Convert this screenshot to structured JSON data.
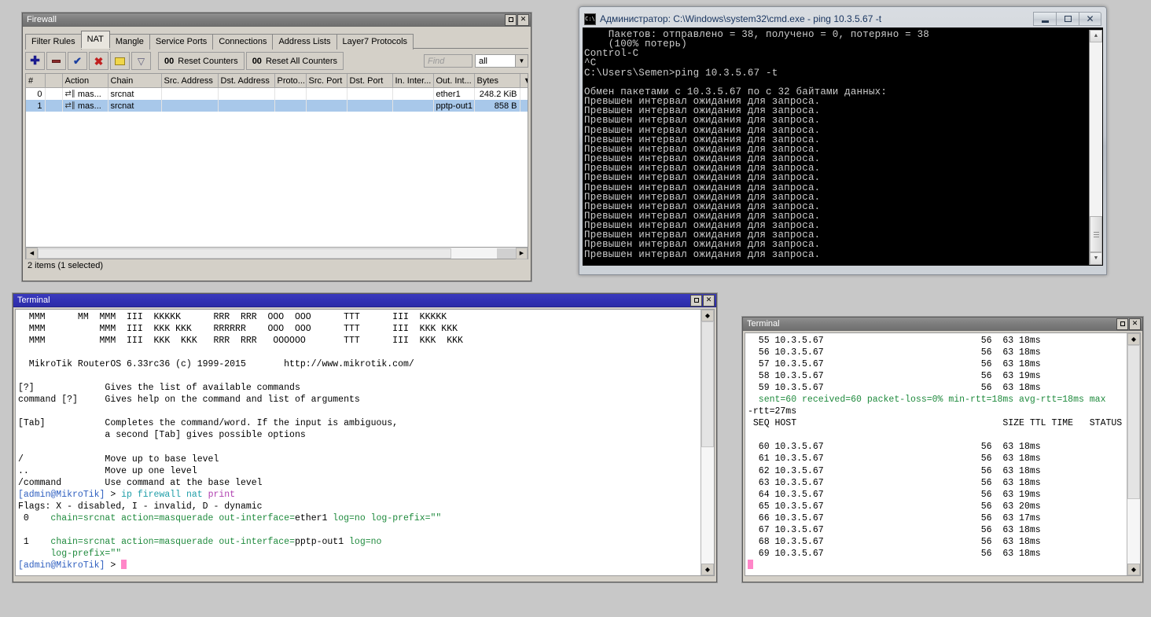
{
  "firewall": {
    "title": "Firewall",
    "window_buttons": {
      "maximize": "maximize-icon",
      "close": "x"
    },
    "tabs": [
      {
        "label": "Filter Rules",
        "active": false
      },
      {
        "label": "NAT",
        "active": true
      },
      {
        "label": "Mangle",
        "active": false
      },
      {
        "label": "Service Ports",
        "active": false
      },
      {
        "label": "Connections",
        "active": false
      },
      {
        "label": "Address Lists",
        "active": false
      },
      {
        "label": "Layer7 Protocols",
        "active": false
      }
    ],
    "toolbar": {
      "add": "+",
      "remove": "-",
      "enable": "check",
      "disable": "x",
      "comment": "folder",
      "filter": "funnel",
      "reset_counters_count": "00",
      "reset_counters_label": "Reset Counters",
      "reset_all_counters_count": "00",
      "reset_all_counters_label": "Reset All Counters",
      "find_placeholder": "Find",
      "filter_value": "all"
    },
    "table": {
      "columns": [
        "#",
        "",
        "Action",
        "Chain",
        "Src. Address",
        "Dst. Address",
        "Proto...",
        "Src. Port",
        "Dst. Port",
        "In. Inter...",
        "Out. Int...",
        "Bytes"
      ],
      "rows": [
        {
          "num": "0",
          "flag": "",
          "action": "mas...",
          "chain": "srcnat",
          "src_address": "",
          "dst_address": "",
          "proto": "",
          "src_port": "",
          "dst_port": "",
          "in_interface": "",
          "out_interface": "ether1",
          "bytes": "248.2 KiB",
          "selected": false
        },
        {
          "num": "1",
          "flag": "",
          "action": "mas...",
          "chain": "srcnat",
          "src_address": "",
          "dst_address": "",
          "proto": "",
          "src_port": "",
          "dst_port": "",
          "in_interface": "",
          "out_interface": "pptp-out1",
          "bytes": "858 B",
          "selected": true
        }
      ]
    },
    "status": "2 items (1 selected)"
  },
  "cmd": {
    "title": "Администратор: C:\\Windows\\system32\\cmd.exe - ping  10.3.5.67 -t",
    "icon": "console-icon",
    "buttons": {
      "minimize": "minimize-icon",
      "maximize": "maximize-icon",
      "close": "close-icon"
    },
    "content": "    Пакетов: отправлено = 38, получено = 0, потеряно = 38\n    (100% потерь)\nControl-C\n^C\nC:\\Users\\Semen>ping 10.3.5.67 -t\n\nОбмен пакетами с 10.3.5.67 по с 32 байтами данных:\nПревышен интервал ожидания для запроса.\nПревышен интервал ожидания для запроса.\nПревышен интервал ожидания для запроса.\nПревышен интервал ожидания для запроса.\nПревышен интервал ожидания для запроса.\nПревышен интервал ожидания для запроса.\nПревышен интервал ожидания для запроса.\nПревышен интервал ожидания для запроса.\nПревышен интервал ожидания для запроса.\nПревышен интервал ожидания для запроса.\nПревышен интервал ожидания для запроса.\nПревышен интервал ожидания для запроса.\nПревышен интервал ожидания для запроса.\nПревышен интервал ожидания для запроса.\nПревышен интервал ожидания для запроса.\nПревышен интервал ожидания для запроса.\nПревышен интервал ожидания для запроса."
  },
  "terminal_left": {
    "title": "Terminal",
    "banner": "  MMM      MM  MMM  III  KKKKK      RRR  RRR  OOO  OOO      TTT      III  KKKKK\n  MMM          MMM  III  KKK KKK    RRRRRR    OOO  OOO      TTT      III  KKK KKK\n  MMM          MMM  III  KKK  KKK   RRR  RRR   OOOOOO       TTT      III  KKK  KKK\n\n  MikroTik RouterOS 6.33rc36 (c) 1999-2015       http://www.mikrotik.com/\n\n[?]             Gives the list of available commands\ncommand [?]     Gives help on the command and list of arguments\n\n[Tab]           Completes the command/word. If the input is ambiguous,\n                a second [Tab] gives possible options\n\n/               Move up to base level\n..              Move up one level\n/command        Use command at the base level",
    "prompt1_user": "[admin@MikroTik]",
    "prompt1_gt": " > ",
    "command1_a": "ip firewall nat ",
    "command1_b": "print",
    "flags_line": "Flags: X - disabled, I - invalid, D - dynamic",
    "rules": [
      {
        "num": " 0",
        "text_chain": "chain=srcnat action=masquerade out-interface=",
        "value1": "ether1",
        "rest": " log=no log-prefix=\"\"",
        "wrap": ""
      },
      {
        "num": " 1",
        "text_chain": "chain=srcnat action=masquerade out-interface=",
        "value1": "pptp-out1",
        "rest": " log=no",
        "wrap": "      log-prefix=\"\""
      }
    ],
    "prompt2_user": "[admin@MikroTik]",
    "prompt2_gt": " > "
  },
  "terminal_right": {
    "title": "Terminal",
    "window_buttons": {
      "maximize": "maximize-icon",
      "close": "x"
    },
    "ping_top_rows": [
      {
        "seq": "55",
        "host": "10.3.5.67",
        "size": "56",
        "ttl": "63",
        "time": "18ms"
      },
      {
        "seq": "56",
        "host": "10.3.5.67",
        "size": "56",
        "ttl": "63",
        "time": "18ms"
      },
      {
        "seq": "57",
        "host": "10.3.5.67",
        "size": "56",
        "ttl": "63",
        "time": "18ms"
      },
      {
        "seq": "58",
        "host": "10.3.5.67",
        "size": "56",
        "ttl": "63",
        "time": "19ms"
      },
      {
        "seq": "59",
        "host": "10.3.5.67",
        "size": "56",
        "ttl": "63",
        "time": "18ms"
      }
    ],
    "summary": "  sent=60 received=60 packet-loss=0% min-rtt=18ms avg-rtt=18ms max",
    "summary_wrap": "-rtt=27ms",
    "header": " SEQ HOST                                      SIZE TTL TIME   STATUS",
    "ping_bottom_rows": [
      {
        "seq": "60",
        "host": "10.3.5.67",
        "size": "56",
        "ttl": "63",
        "time": "18ms"
      },
      {
        "seq": "61",
        "host": "10.3.5.67",
        "size": "56",
        "ttl": "63",
        "time": "18ms"
      },
      {
        "seq": "62",
        "host": "10.3.5.67",
        "size": "56",
        "ttl": "63",
        "time": "18ms"
      },
      {
        "seq": "63",
        "host": "10.3.5.67",
        "size": "56",
        "ttl": "63",
        "time": "18ms"
      },
      {
        "seq": "64",
        "host": "10.3.5.67",
        "size": "56",
        "ttl": "63",
        "time": "19ms"
      },
      {
        "seq": "65",
        "host": "10.3.5.67",
        "size": "56",
        "ttl": "63",
        "time": "20ms"
      },
      {
        "seq": "66",
        "host": "10.3.5.67",
        "size": "56",
        "ttl": "63",
        "time": "17ms"
      },
      {
        "seq": "67",
        "host": "10.3.5.67",
        "size": "56",
        "ttl": "63",
        "time": "18ms"
      },
      {
        "seq": "68",
        "host": "10.3.5.67",
        "size": "56",
        "ttl": "63",
        "time": "18ms"
      },
      {
        "seq": "69",
        "host": "10.3.5.67",
        "size": "56",
        "ttl": "63",
        "time": "18ms"
      }
    ]
  },
  "colors": {
    "desktop": "#c8c8c8",
    "winbox_face": "#d4d0c8",
    "title_blue": "#3232b4",
    "title_gray": "#7d7d7d",
    "row_selected": "#a8c8ea",
    "console_bg": "#000000",
    "console_fg": "#cccccc",
    "term_green": "#1f8a3d",
    "cursor_pink": "#ff86c8"
  }
}
